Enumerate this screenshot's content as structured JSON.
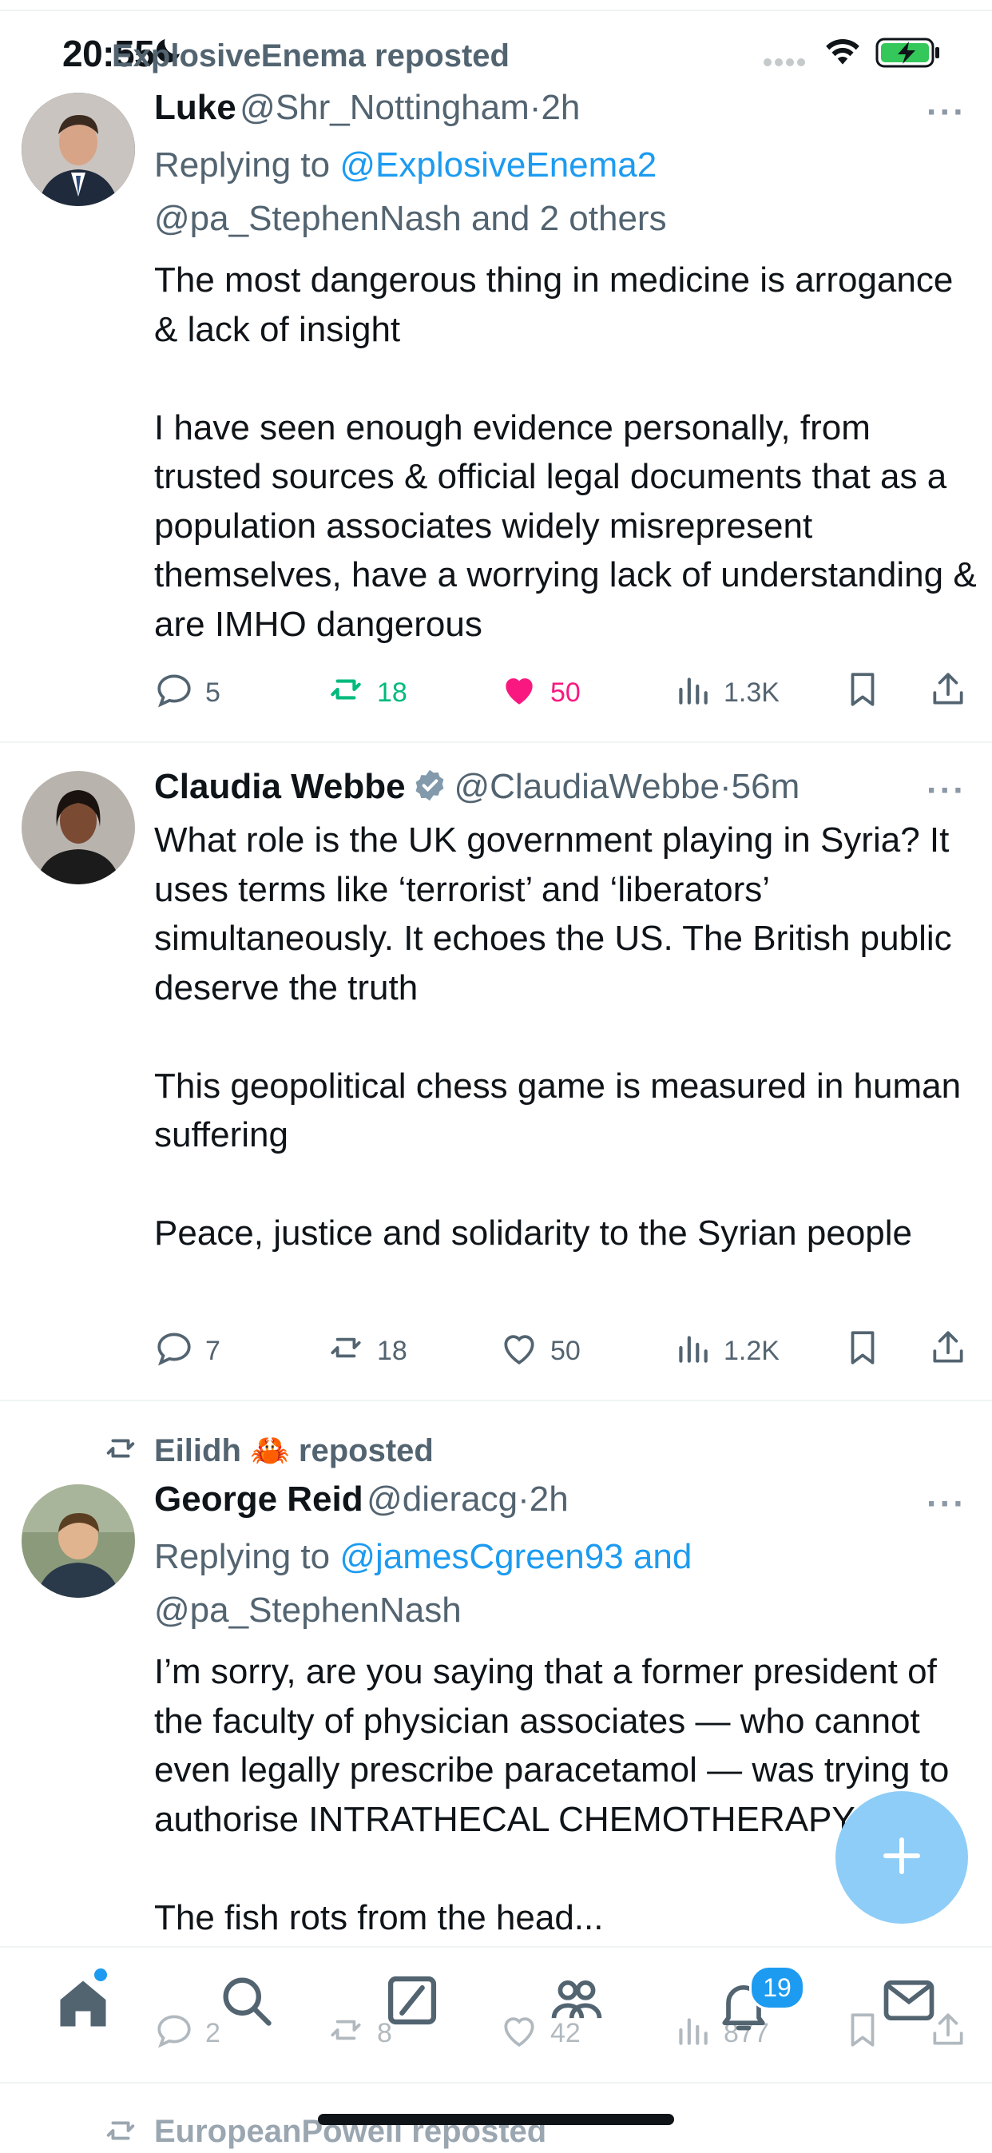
{
  "status_bar": {
    "time": "20:55"
  },
  "colors": {
    "accent": "#1d9bf0",
    "like": "#f91880",
    "retweet": "#00ba7c",
    "gray": "#536471"
  },
  "posts": [
    {
      "repost_label": "ExplosiveEnema reposted",
      "name": "Luke",
      "handle": "@Shr_Nottingham",
      "dot": "·",
      "time": "2h",
      "reply_prefix": "Replying to",
      "reply_mention_1": "@ExplosiveEnema2",
      "reply_mention_2": "@pa_StephenNash and 2 others",
      "text": "The most dangerous thing in medicine is arrogance & lack of insight\n\nI have seen enough evidence personally, from trusted sources & official legal documents that as a population associates widely misrepresent themselves, have a worrying lack of understanding & are IMHO dangerous",
      "replies": "5",
      "reposts": "18",
      "likes": "50",
      "views": "1.3K"
    },
    {
      "name": "Claudia Webbe",
      "handle": "@ClaudiaWebbe",
      "dot": "·",
      "time": "56m",
      "text": "What role is the UK government playing in Syria? It uses terms like ‘terrorist’ and ‘liberators’ simultaneously. It echoes the US. The British public deserve the truth\n\nThis geopolitical chess game is measured in human suffering\n\nPeace, justice and solidarity to the Syrian people",
      "replies": "7",
      "reposts": "18",
      "likes": "50",
      "views": "1.2K"
    },
    {
      "repost_label": "Eilidh 🦀 reposted",
      "name": "George Reid",
      "handle": "@dieracg",
      "dot": "·",
      "time": "2h",
      "reply_prefix": "Replying to",
      "reply_mention_1": "@jamesCgreen93 and",
      "reply_mention_2": "@pa_StephenNash",
      "text": "I’m sorry, are you saying that a former president of the faculty of physician associates — who cannot even legally prescribe paracetamol — was trying to authorise INTRATHECAL CHEMOTHERAPY?!\n\nThe fish rots from the head...",
      "replies": "2",
      "reposts": "8",
      "likes": "42",
      "views": "877"
    }
  ],
  "next_repost_label": "EuropeanPowell reposted",
  "tabbar": {
    "notifications_badge": "19"
  },
  "icons": [
    "home-icon",
    "search-icon",
    "grok-icon",
    "communities-icon",
    "notifications-icon",
    "messages-icon",
    "compose-plus-icon",
    "reply-icon",
    "repost-icon",
    "like-icon",
    "views-icon",
    "bookmark-icon",
    "share-icon",
    "more-icon",
    "verified-badge-icon"
  ]
}
